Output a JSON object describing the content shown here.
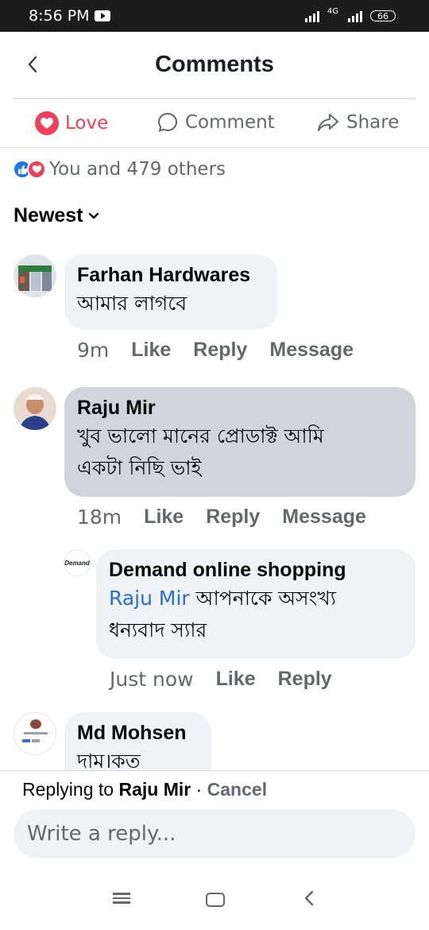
{
  "status_bar": {
    "time": "8:56 PM",
    "network": "4G",
    "battery": "66"
  },
  "header": {
    "title": "Comments",
    "back": "‹"
  },
  "actions": {
    "love": "Love",
    "comment": "Comment",
    "share": "Share"
  },
  "reactions": {
    "summary": "You and 479 others"
  },
  "sort": {
    "label": "Newest"
  },
  "comments": [
    {
      "name": "Farhan Hardwares",
      "text": "আমার লাগবে",
      "time": "9m",
      "like": "Like",
      "reply": "Reply",
      "message": "Message"
    },
    {
      "name": "Raju Mir",
      "text_line1": "খুব ভালো মানের প্রোডাক্ট আমি",
      "text_line2": "একটা নিছি ভাই",
      "time": "18m",
      "like": "Like",
      "reply": "Reply",
      "message": "Message"
    },
    {
      "name": "Demand online shopping",
      "avatar_label": "Demand",
      "mention": "Raju Mir",
      "text_line1_rest": " আপনাকে অসংখ্য",
      "text_line2": "ধন্যবাদ স্যার",
      "time": "Just now",
      "like": "Like",
      "reply": "Reply"
    },
    {
      "name": "Md Mohsen",
      "text": "দাম।কত"
    }
  ],
  "reply_bar": {
    "prefix": "Replying to ",
    "target": "Raju Mir",
    "separator": " · ",
    "cancel": "Cancel",
    "placeholder": "Write a reply..."
  },
  "colors": {
    "love": "#f33e58",
    "like": "#1877f2",
    "bubble": "#f0f2f5",
    "highlight_bubble": "#d1d5db",
    "mention": "#216fdb"
  }
}
